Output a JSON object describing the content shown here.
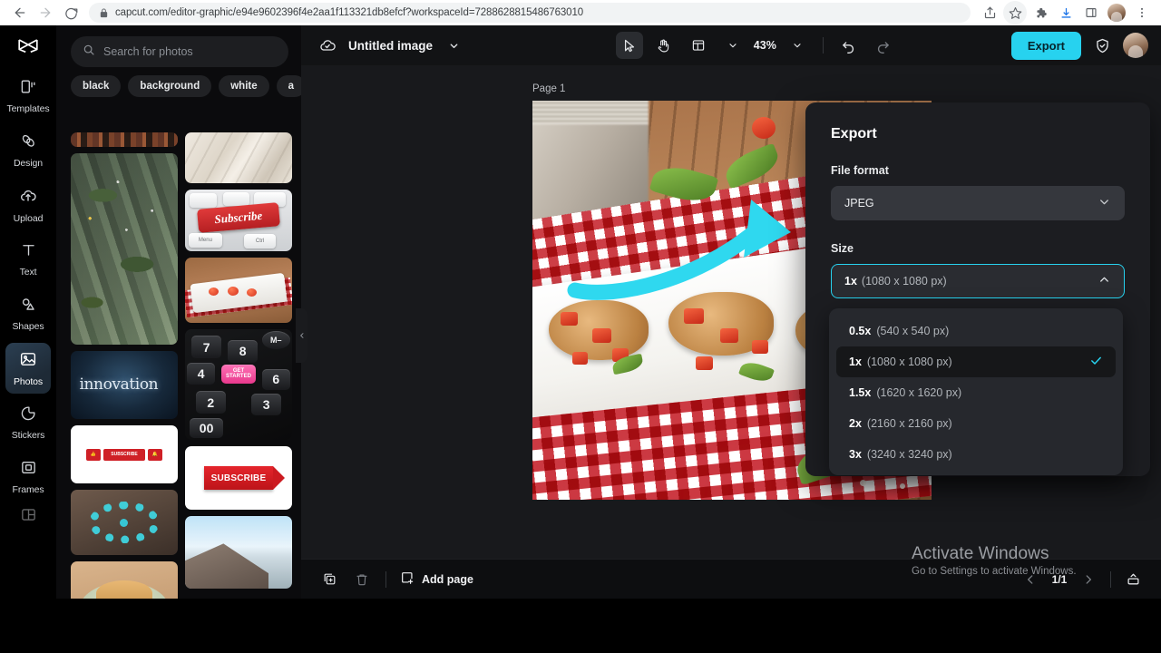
{
  "browser": {
    "url": "capcut.com/editor-graphic/e94e9602396f4e2aa1f113321db8efcf?workspaceId=7288628815486763010",
    "back_icon": "back-arrow-icon",
    "forward_icon": "forward-arrow-icon",
    "reload_icon": "reload-icon",
    "lock_icon": "lock-icon",
    "icons": [
      "share-icon",
      "bookmark-star-icon",
      "extensions-puzzle-icon",
      "download-icon",
      "sidebar-panel-icon",
      "profile-avatar",
      "more-menu-icon"
    ]
  },
  "rail": {
    "logo": "capcut-logo",
    "items": [
      {
        "label": "Templates",
        "icon": "templates-icon",
        "active": false
      },
      {
        "label": "Design",
        "icon": "design-icon",
        "active": false
      },
      {
        "label": "Upload",
        "icon": "upload-cloud-icon",
        "active": false
      },
      {
        "label": "Text",
        "icon": "text-icon",
        "active": false
      },
      {
        "label": "Shapes",
        "icon": "shapes-icon",
        "active": false
      },
      {
        "label": "Photos",
        "icon": "photos-icon",
        "active": true
      },
      {
        "label": "Stickers",
        "icon": "stickers-icon",
        "active": false
      },
      {
        "label": "Frames",
        "icon": "frames-icon",
        "active": false
      }
    ]
  },
  "panel": {
    "search": {
      "placeholder": "Search for photos",
      "icon": "search-icon"
    },
    "chips": [
      "black",
      "background",
      "white",
      "a"
    ],
    "thumbnails": [
      {
        "name": "city-street-strip",
        "alt": "street lights strip"
      },
      {
        "name": "aerial-road-junction",
        "alt": "aerial view of road junction"
      },
      {
        "name": "innovation-text",
        "alt": "innovation word on dark blue"
      },
      {
        "name": "subscribe-bar-white",
        "alt": "subscribe bar on white"
      },
      {
        "name": "turquoise-bead-bracelet",
        "alt": "turquoise bead bracelet"
      },
      {
        "name": "veggie-burger-plate",
        "alt": "veggie burger on plate"
      },
      {
        "name": "white-fabric",
        "alt": "white fabric folds"
      },
      {
        "name": "subscribe-keyboard-key",
        "alt": "red Subscribe keyboard key"
      },
      {
        "name": "bruschetta-tray",
        "alt": "bruschetta on checkered cloth"
      },
      {
        "name": "calculator-keys",
        "alt": "black calculator keys with pink Get Started key"
      },
      {
        "name": "subscribe-arrow-banner",
        "alt": "red SUBSCRIBE arrow banner"
      },
      {
        "name": "mountain-sky",
        "alt": "mountain and blue sky"
      }
    ],
    "thumb_texts": {
      "innovation": "innovation",
      "subscribe_key": "Subscribe",
      "key_menu": "Menu",
      "key_ctrl": "Ctrl",
      "subscribe_bar": "SUBSCRIBE",
      "subscribe_arrow": "SUBSCRIBE",
      "calc_7": "7",
      "calc_8": "8",
      "calc_4": "4",
      "calc_6": "6",
      "calc_2": "2",
      "calc_3": "3",
      "calc_00": "00",
      "calc_m": "M–",
      "get_started": "GET STARTED"
    },
    "collapse_icon": "chevron-left-icon"
  },
  "topbar": {
    "cloud_icon": "cloud-saved-icon",
    "title": "Untitled image",
    "title_caret": "chevron-down-icon",
    "tools": [
      {
        "name": "select-tool",
        "icon": "cursor-arrow-icon",
        "active": true
      },
      {
        "name": "hand-tool",
        "icon": "hand-icon",
        "active": false
      },
      {
        "name": "layout-tool",
        "icon": "layout-panel-icon",
        "active": false
      }
    ],
    "zoom_level": "43%",
    "zoom_caret": "chevron-down-icon",
    "undo_icon": "undo-icon",
    "redo_icon": "redo-icon",
    "export_label": "Export",
    "shield_icon": "shield-check-icon",
    "avatar": "user-avatar"
  },
  "canvas": {
    "page_label": "Page 1",
    "artwork": "bruschetta-tomato-basil-photo",
    "annotation": "cyan-curved-arrow"
  },
  "bottombar": {
    "duplicate_icon": "duplicate-page-icon",
    "delete_icon": "trash-icon",
    "add_page_label": "Add page",
    "add_page_icon": "add-page-icon",
    "prev_icon": "chevron-left-icon",
    "next_icon": "chevron-right-icon",
    "page_indicator": "1/1",
    "expand_icon": "expand-panel-icon"
  },
  "export_panel": {
    "title": "Export",
    "file_format_label": "File format",
    "file_format_value": "JPEG",
    "file_format_caret": "chevron-down-icon",
    "size_label": "Size",
    "size_value_multiplier": "1x",
    "size_value_dims": "(1080 x 1080 px)",
    "size_caret": "chevron-up-icon",
    "size_options": [
      {
        "multiplier": "0.5x",
        "dims": "(540 x 540 px)",
        "selected": false
      },
      {
        "multiplier": "1x",
        "dims": "(1080 x 1080 px)",
        "selected": true
      },
      {
        "multiplier": "1.5x",
        "dims": "(1620 x 1620 px)",
        "selected": false
      },
      {
        "multiplier": "2x",
        "dims": "(2160 x 2160 px)",
        "selected": false
      },
      {
        "multiplier": "3x",
        "dims": "(3240 x 3240 px)",
        "selected": false
      }
    ],
    "check_icon": "check-icon"
  },
  "watermark": {
    "line1": "Activate Windows",
    "line2": "Go to Settings to activate Windows."
  },
  "colors": {
    "accent": "#27d2ef",
    "panel_bg": "#1c1d21",
    "app_bg": "#121315",
    "rail_bg": "#000000"
  }
}
